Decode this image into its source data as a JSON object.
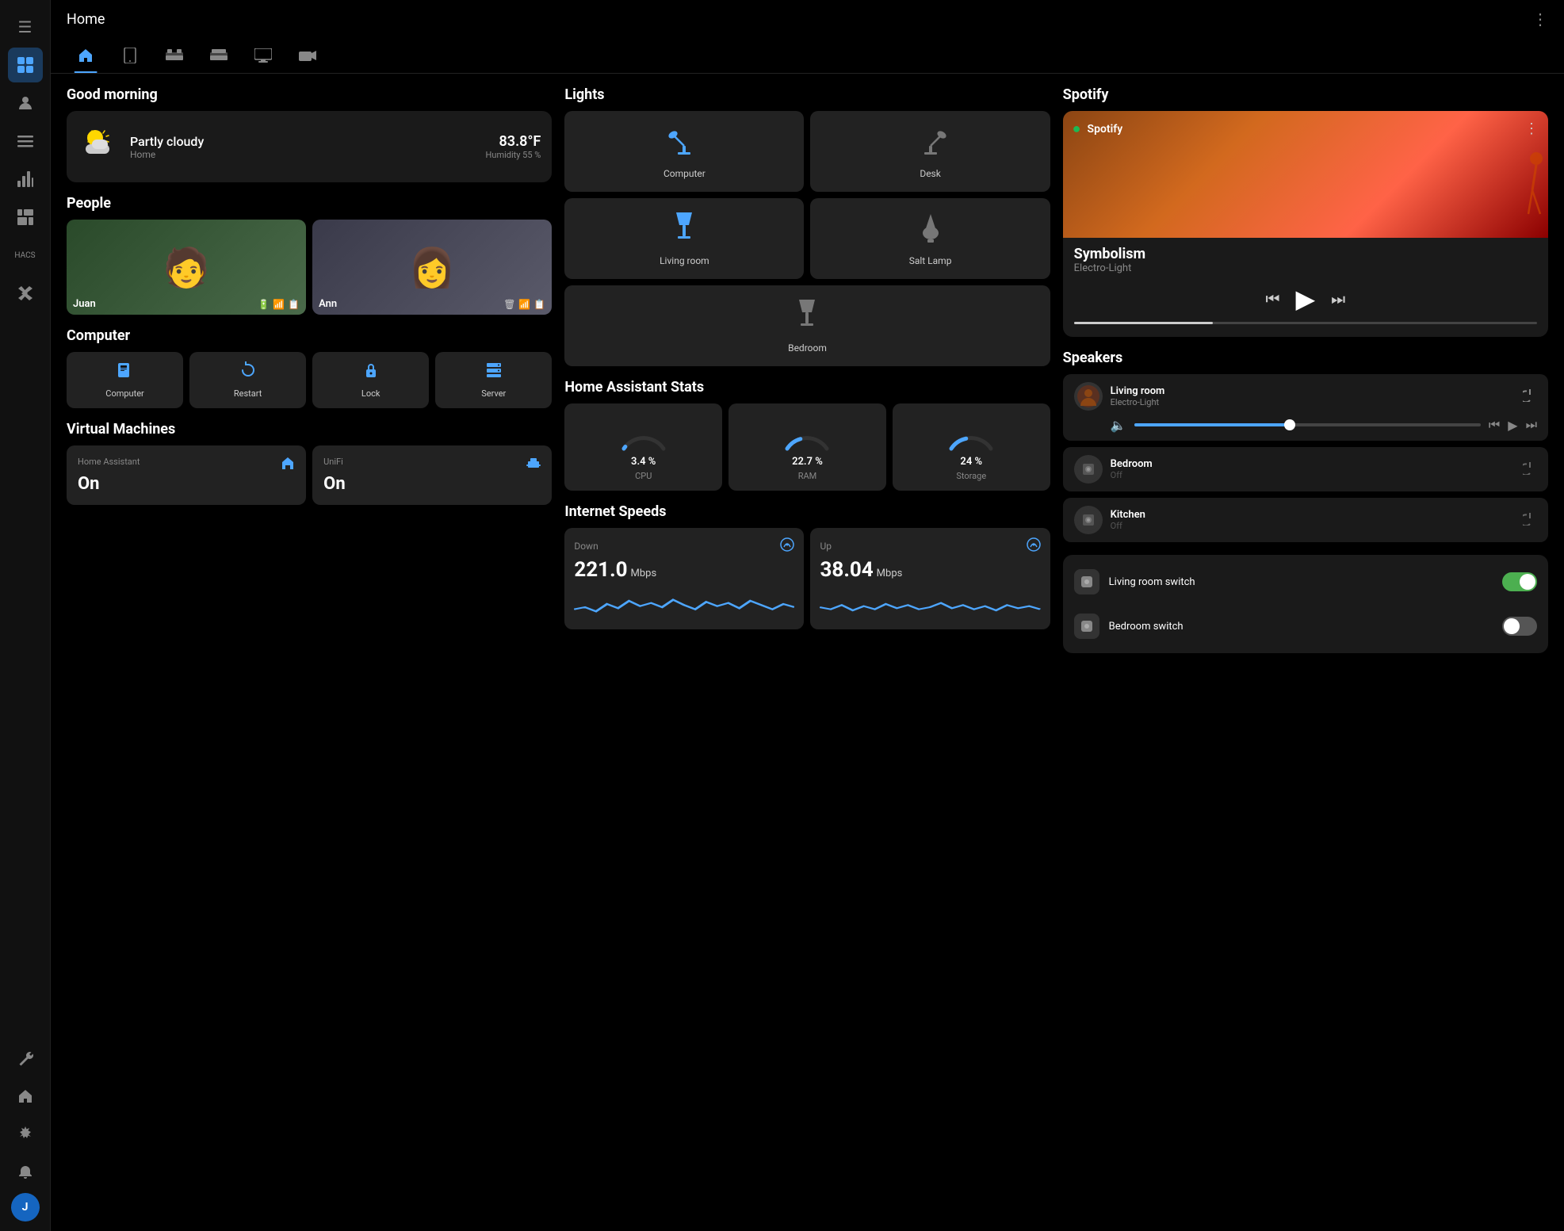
{
  "app": {
    "title": "Home",
    "more_icon": "⋮",
    "menu_icon": "≡"
  },
  "sidebar": {
    "items": [
      {
        "id": "dashboard",
        "icon": "⊞",
        "active": true
      },
      {
        "id": "person",
        "icon": "👤",
        "active": false
      },
      {
        "id": "list",
        "icon": "☰",
        "active": false
      },
      {
        "id": "chart",
        "icon": "📊",
        "active": false
      },
      {
        "id": "grid",
        "icon": "⊟",
        "active": false
      },
      {
        "id": "hacs",
        "icon": "◫",
        "active": false
      },
      {
        "id": "vscode",
        "icon": "◈",
        "active": false
      }
    ],
    "bottom": [
      {
        "id": "wrench",
        "icon": "🔧"
      },
      {
        "id": "home2",
        "icon": "⌂"
      },
      {
        "id": "settings",
        "icon": "⚙"
      },
      {
        "id": "bell",
        "icon": "🔔"
      }
    ],
    "avatar_label": "J"
  },
  "nav_tabs": [
    {
      "id": "home",
      "icon": "🏠",
      "active": true
    },
    {
      "id": "tablet",
      "icon": "📱",
      "active": false
    },
    {
      "id": "bed1",
      "icon": "🛏",
      "active": false
    },
    {
      "id": "bed2",
      "icon": "🛏",
      "active": false
    },
    {
      "id": "monitor",
      "icon": "🖥",
      "active": false
    },
    {
      "id": "camera",
      "icon": "📷",
      "active": false
    }
  ],
  "greeting": {
    "section_title": "Good morning"
  },
  "weather": {
    "condition": "Partly cloudy",
    "location": "Home",
    "temperature": "83.8°F",
    "humidity": "Humidity 55 %"
  },
  "people": {
    "section_title": "People",
    "persons": [
      {
        "name": "Juan",
        "icons": [
          "🔋",
          "📶",
          "📋"
        ]
      },
      {
        "name": "Ann",
        "icons": [
          "🗑",
          "📶",
          "📋"
        ]
      }
    ]
  },
  "computer": {
    "section_title": "Computer",
    "buttons": [
      {
        "id": "computer",
        "label": "Computer",
        "icon": "💻"
      },
      {
        "id": "restart",
        "label": "Restart",
        "icon": "↺"
      },
      {
        "id": "lock",
        "label": "Lock",
        "icon": "🔒"
      },
      {
        "id": "server",
        "label": "Server",
        "icon": "🖥"
      }
    ]
  },
  "virtual_machines": {
    "section_title": "Virtual Machines",
    "vms": [
      {
        "name": "Home Assistant",
        "status": "On",
        "icon": "🏠"
      },
      {
        "name": "UniFi",
        "status": "On",
        "icon": "🖧"
      }
    ]
  },
  "lights": {
    "section_title": "Lights",
    "items": [
      {
        "id": "computer",
        "label": "Computer",
        "active": true
      },
      {
        "id": "desk",
        "label": "Desk",
        "active": false
      },
      {
        "id": "living_room",
        "label": "Living room",
        "active": true
      },
      {
        "id": "salt_lamp",
        "label": "Salt Lamp",
        "active": false
      },
      {
        "id": "bedroom",
        "label": "Bedroom",
        "active": false
      }
    ]
  },
  "ha_stats": {
    "section_title": "Home Assistant Stats",
    "items": [
      {
        "label": "CPU",
        "value": "3.4 %",
        "percent": 3.4,
        "color": "#4da6ff"
      },
      {
        "label": "RAM",
        "value": "22.7 %",
        "percent": 22.7,
        "color": "#4da6ff"
      },
      {
        "label": "Storage",
        "value": "24 %",
        "percent": 24,
        "color": "#4da6ff"
      }
    ]
  },
  "internet": {
    "section_title": "Internet Speeds",
    "down": {
      "label": "Down",
      "value": "221.0",
      "unit": "Mbps"
    },
    "up": {
      "label": "Up",
      "value": "38.04",
      "unit": "Mbps"
    }
  },
  "spotify": {
    "section_title": "Spotify",
    "brand": "Spotify",
    "song": "Symbolism",
    "artist": "Electro-Light",
    "progress_percent": 30
  },
  "speakers": {
    "section_title": "Speakers",
    "items": [
      {
        "name": "Living room",
        "track": "Electro-Light",
        "on": true,
        "volume": 45
      },
      {
        "name": "Bedroom",
        "track": "Off",
        "on": false
      },
      {
        "name": "Kitchen",
        "track": "Off",
        "on": false
      }
    ]
  },
  "switches": {
    "items": [
      {
        "name": "Living room switch",
        "on": true
      },
      {
        "name": "Bedroom switch",
        "on": false
      }
    ]
  }
}
